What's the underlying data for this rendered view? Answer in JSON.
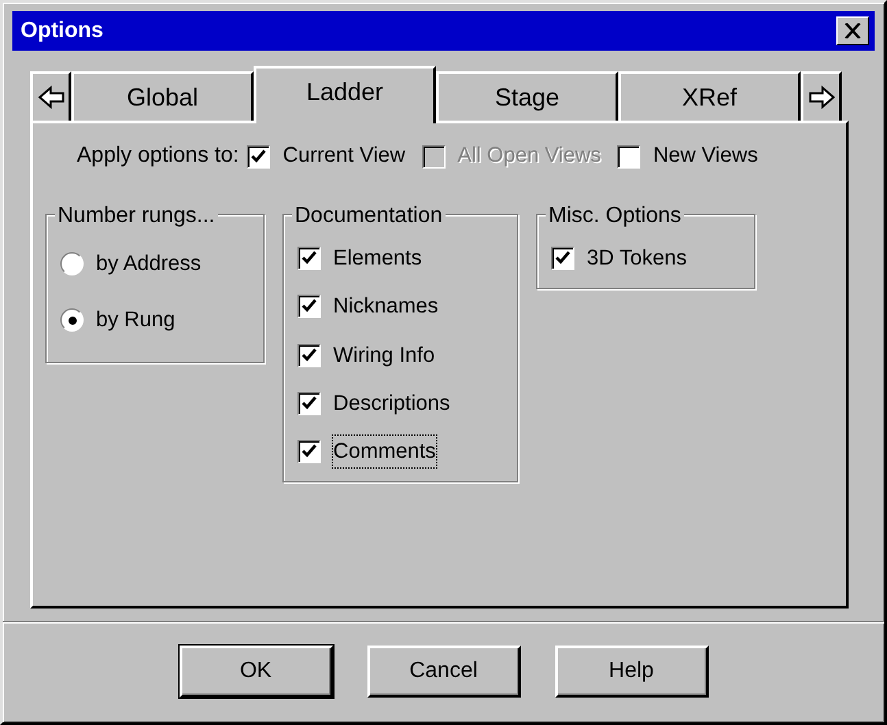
{
  "window": {
    "title": "Options"
  },
  "tabs": [
    {
      "label": "Global",
      "selected": false
    },
    {
      "label": "Ladder",
      "selected": true
    },
    {
      "label": "Stage",
      "selected": false
    },
    {
      "label": "XRef",
      "selected": false
    }
  ],
  "apply_options": {
    "label": "Apply options to:",
    "targets": [
      {
        "label": "Current View",
        "checked": true,
        "disabled": false
      },
      {
        "label": "All Open Views",
        "checked": false,
        "disabled": true
      },
      {
        "label": "New Views",
        "checked": false,
        "disabled": false
      }
    ]
  },
  "groups": [
    {
      "title": "Number rungs...",
      "kind": "radio",
      "items": [
        {
          "label": "by Address",
          "selected": false
        },
        {
          "label": "by Rung",
          "selected": true
        }
      ]
    },
    {
      "title": "Documentation",
      "kind": "checkbox",
      "items": [
        {
          "label": "Elements",
          "checked": true,
          "focused": false
        },
        {
          "label": "Nicknames",
          "checked": true,
          "focused": false
        },
        {
          "label": "Wiring Info",
          "checked": true,
          "focused": false
        },
        {
          "label": "Descriptions",
          "checked": true,
          "focused": false
        },
        {
          "label": "Comments",
          "checked": true,
          "focused": true
        }
      ]
    },
    {
      "title": "Misc. Options",
      "kind": "checkbox",
      "items": [
        {
          "label": "3D Tokens",
          "checked": true,
          "focused": false
        }
      ]
    }
  ],
  "buttons": [
    {
      "label": "OK",
      "default": true
    },
    {
      "label": "Cancel",
      "default": false
    },
    {
      "label": "Help",
      "default": false
    }
  ]
}
